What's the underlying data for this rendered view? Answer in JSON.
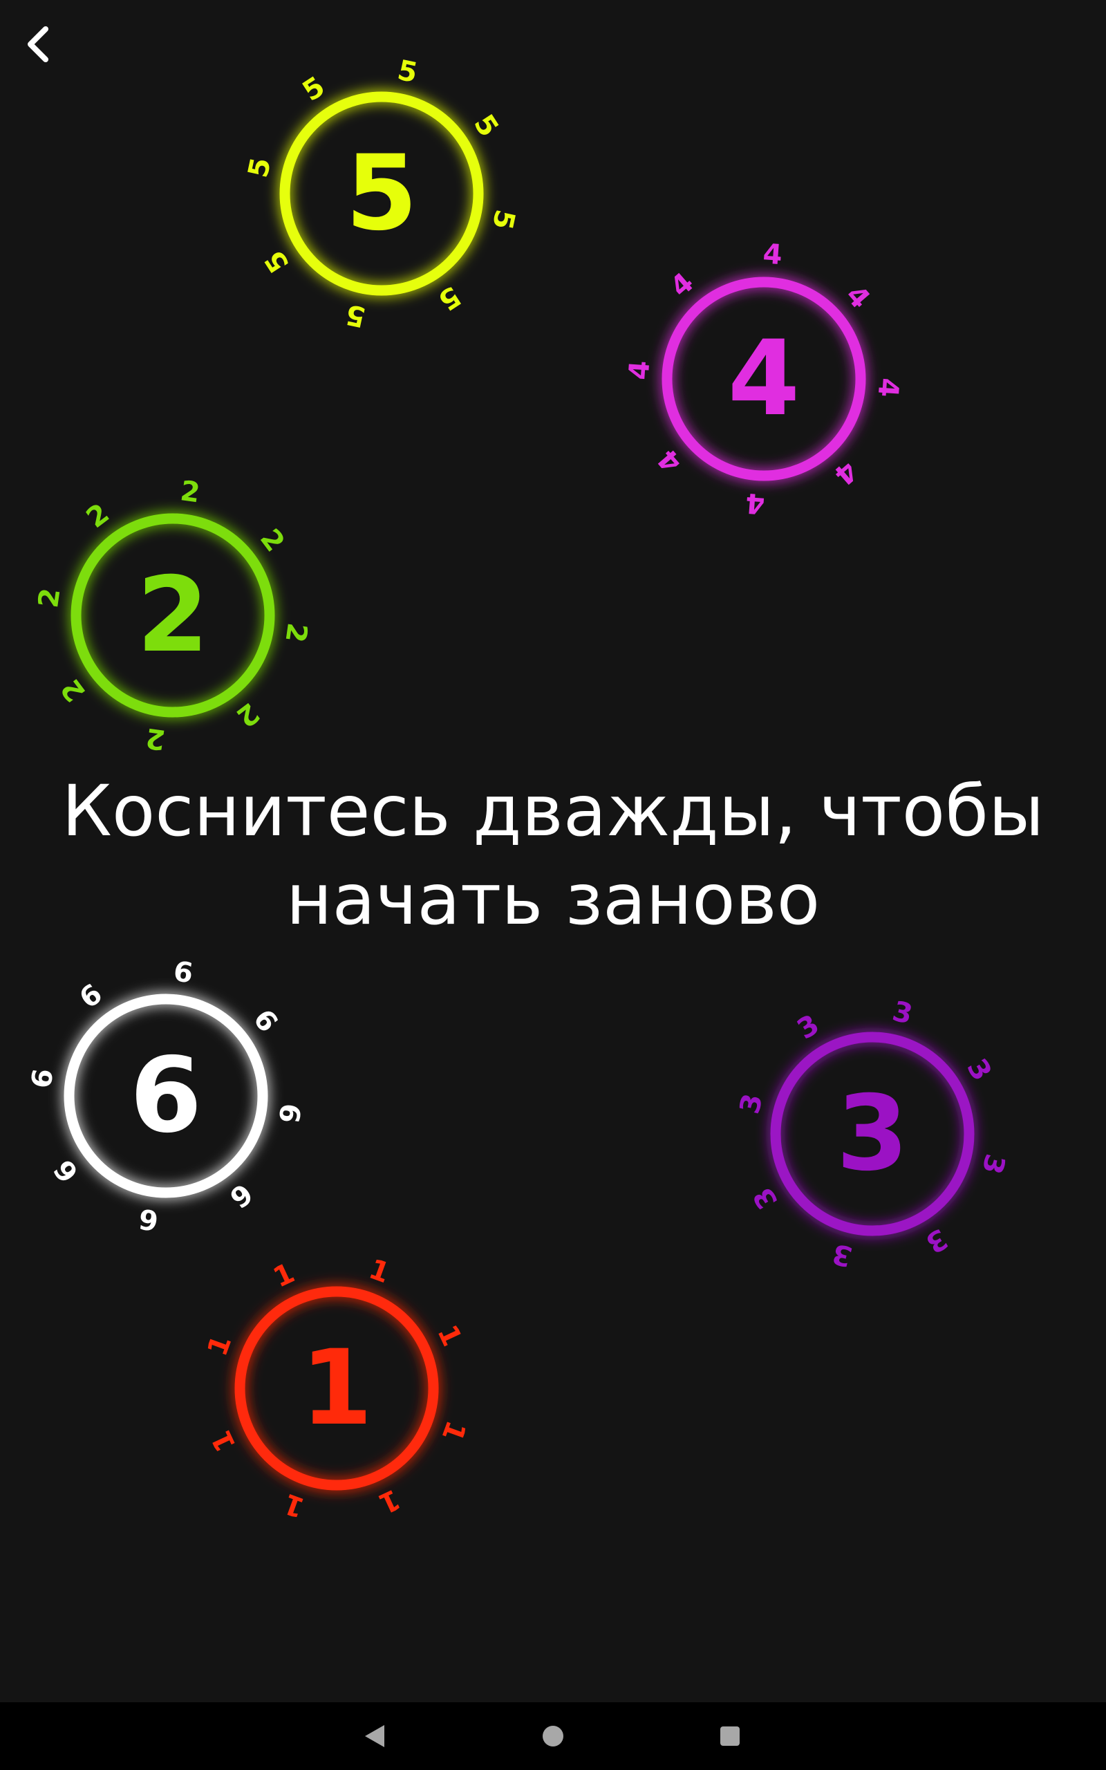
{
  "toolbar": {
    "back_icon": "chevron-left-icon"
  },
  "instruction": {
    "line1": "Коснитесь дважды, чтобы",
    "line2": "начать заново"
  },
  "fingers": [
    {
      "label": "5",
      "color": "#e6ff0a",
      "orbit": [
        "5",
        "5",
        "5",
        "5",
        "5",
        "5",
        "5",
        "5"
      ]
    },
    {
      "label": "4",
      "color": "#e02ee0",
      "orbit": [
        "4",
        "4",
        "4",
        "4",
        "4",
        "4",
        "4",
        "4"
      ]
    },
    {
      "label": "2",
      "color": "#7ddd0c",
      "orbit": [
        "2",
        "2",
        "2",
        "2",
        "2",
        "2",
        "2",
        "2"
      ]
    },
    {
      "label": "6",
      "color": "#ffffff",
      "orbit": [
        "6",
        "6",
        "6",
        "6",
        "6",
        "6",
        "6",
        "6"
      ]
    },
    {
      "label": "3",
      "color": "#9b12c4",
      "orbit": [
        "3",
        "3",
        "3",
        "3",
        "3",
        "3",
        "3",
        "3"
      ]
    },
    {
      "label": "1",
      "color": "#ff2a0a",
      "orbit": [
        "1",
        "1",
        "1",
        "1",
        "1",
        "1",
        "1",
        "1"
      ]
    }
  ],
  "navigation": {
    "back_icon": "triangle-back-icon",
    "home_icon": "circle-home-icon",
    "recents_icon": "square-recents-icon"
  }
}
